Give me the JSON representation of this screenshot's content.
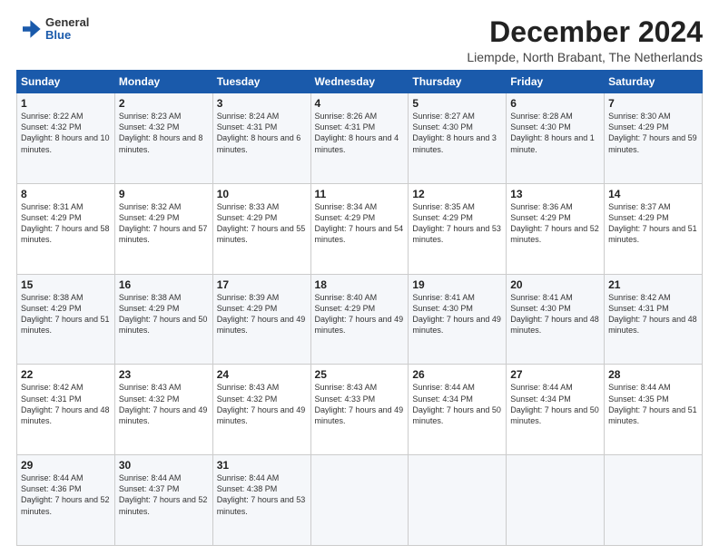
{
  "logo": {
    "general": "General",
    "blue": "Blue"
  },
  "title": "December 2024",
  "subtitle": "Liempde, North Brabant, The Netherlands",
  "days_of_week": [
    "Sunday",
    "Monday",
    "Tuesday",
    "Wednesday",
    "Thursday",
    "Friday",
    "Saturday"
  ],
  "weeks": [
    [
      {
        "day": "1",
        "sunrise": "8:22 AM",
        "sunset": "4:32 PM",
        "daylight": "8 hours and 10 minutes."
      },
      {
        "day": "2",
        "sunrise": "8:23 AM",
        "sunset": "4:32 PM",
        "daylight": "8 hours and 8 minutes."
      },
      {
        "day": "3",
        "sunrise": "8:24 AM",
        "sunset": "4:31 PM",
        "daylight": "8 hours and 6 minutes."
      },
      {
        "day": "4",
        "sunrise": "8:26 AM",
        "sunset": "4:31 PM",
        "daylight": "8 hours and 4 minutes."
      },
      {
        "day": "5",
        "sunrise": "8:27 AM",
        "sunset": "4:30 PM",
        "daylight": "8 hours and 3 minutes."
      },
      {
        "day": "6",
        "sunrise": "8:28 AM",
        "sunset": "4:30 PM",
        "daylight": "8 hours and 1 minute."
      },
      {
        "day": "7",
        "sunrise": "8:30 AM",
        "sunset": "4:29 PM",
        "daylight": "7 hours and 59 minutes."
      }
    ],
    [
      {
        "day": "8",
        "sunrise": "8:31 AM",
        "sunset": "4:29 PM",
        "daylight": "7 hours and 58 minutes."
      },
      {
        "day": "9",
        "sunrise": "8:32 AM",
        "sunset": "4:29 PM",
        "daylight": "7 hours and 57 minutes."
      },
      {
        "day": "10",
        "sunrise": "8:33 AM",
        "sunset": "4:29 PM",
        "daylight": "7 hours and 55 minutes."
      },
      {
        "day": "11",
        "sunrise": "8:34 AM",
        "sunset": "4:29 PM",
        "daylight": "7 hours and 54 minutes."
      },
      {
        "day": "12",
        "sunrise": "8:35 AM",
        "sunset": "4:29 PM",
        "daylight": "7 hours and 53 minutes."
      },
      {
        "day": "13",
        "sunrise": "8:36 AM",
        "sunset": "4:29 PM",
        "daylight": "7 hours and 52 minutes."
      },
      {
        "day": "14",
        "sunrise": "8:37 AM",
        "sunset": "4:29 PM",
        "daylight": "7 hours and 51 minutes."
      }
    ],
    [
      {
        "day": "15",
        "sunrise": "8:38 AM",
        "sunset": "4:29 PM",
        "daylight": "7 hours and 51 minutes."
      },
      {
        "day": "16",
        "sunrise": "8:38 AM",
        "sunset": "4:29 PM",
        "daylight": "7 hours and 50 minutes."
      },
      {
        "day": "17",
        "sunrise": "8:39 AM",
        "sunset": "4:29 PM",
        "daylight": "7 hours and 49 minutes."
      },
      {
        "day": "18",
        "sunrise": "8:40 AM",
        "sunset": "4:29 PM",
        "daylight": "7 hours and 49 minutes."
      },
      {
        "day": "19",
        "sunrise": "8:41 AM",
        "sunset": "4:30 PM",
        "daylight": "7 hours and 49 minutes."
      },
      {
        "day": "20",
        "sunrise": "8:41 AM",
        "sunset": "4:30 PM",
        "daylight": "7 hours and 48 minutes."
      },
      {
        "day": "21",
        "sunrise": "8:42 AM",
        "sunset": "4:31 PM",
        "daylight": "7 hours and 48 minutes."
      }
    ],
    [
      {
        "day": "22",
        "sunrise": "8:42 AM",
        "sunset": "4:31 PM",
        "daylight": "7 hours and 48 minutes."
      },
      {
        "day": "23",
        "sunrise": "8:43 AM",
        "sunset": "4:32 PM",
        "daylight": "7 hours and 49 minutes."
      },
      {
        "day": "24",
        "sunrise": "8:43 AM",
        "sunset": "4:32 PM",
        "daylight": "7 hours and 49 minutes."
      },
      {
        "day": "25",
        "sunrise": "8:43 AM",
        "sunset": "4:33 PM",
        "daylight": "7 hours and 49 minutes."
      },
      {
        "day": "26",
        "sunrise": "8:44 AM",
        "sunset": "4:34 PM",
        "daylight": "7 hours and 50 minutes."
      },
      {
        "day": "27",
        "sunrise": "8:44 AM",
        "sunset": "4:34 PM",
        "daylight": "7 hours and 50 minutes."
      },
      {
        "day": "28",
        "sunrise": "8:44 AM",
        "sunset": "4:35 PM",
        "daylight": "7 hours and 51 minutes."
      }
    ],
    [
      {
        "day": "29",
        "sunrise": "8:44 AM",
        "sunset": "4:36 PM",
        "daylight": "7 hours and 52 minutes."
      },
      {
        "day": "30",
        "sunrise": "8:44 AM",
        "sunset": "4:37 PM",
        "daylight": "7 hours and 52 minutes."
      },
      {
        "day": "31",
        "sunrise": "8:44 AM",
        "sunset": "4:38 PM",
        "daylight": "7 hours and 53 minutes."
      },
      null,
      null,
      null,
      null
    ]
  ]
}
